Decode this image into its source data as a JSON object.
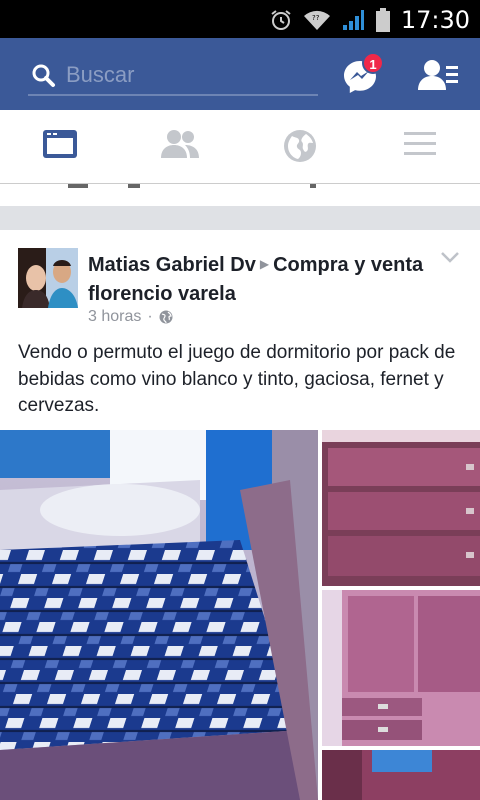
{
  "status_bar": {
    "time": "17:30"
  },
  "search": {
    "placeholder": "Buscar"
  },
  "messenger": {
    "badge": "1"
  },
  "tabs": [
    "news-feed",
    "friends",
    "notifications",
    "more"
  ],
  "post": {
    "author": "Matias Gabriel Dv",
    "group": "Compra y venta florencio varela",
    "time": "3 horas",
    "separator": "·",
    "text": "Vendo o permuto el juego de dormitorio por pack de bebidas como vino blanco y tinto, gaciosa, fernet y cervezas."
  },
  "colors": {
    "brand": "#3b5998",
    "badge": "#f02849"
  }
}
